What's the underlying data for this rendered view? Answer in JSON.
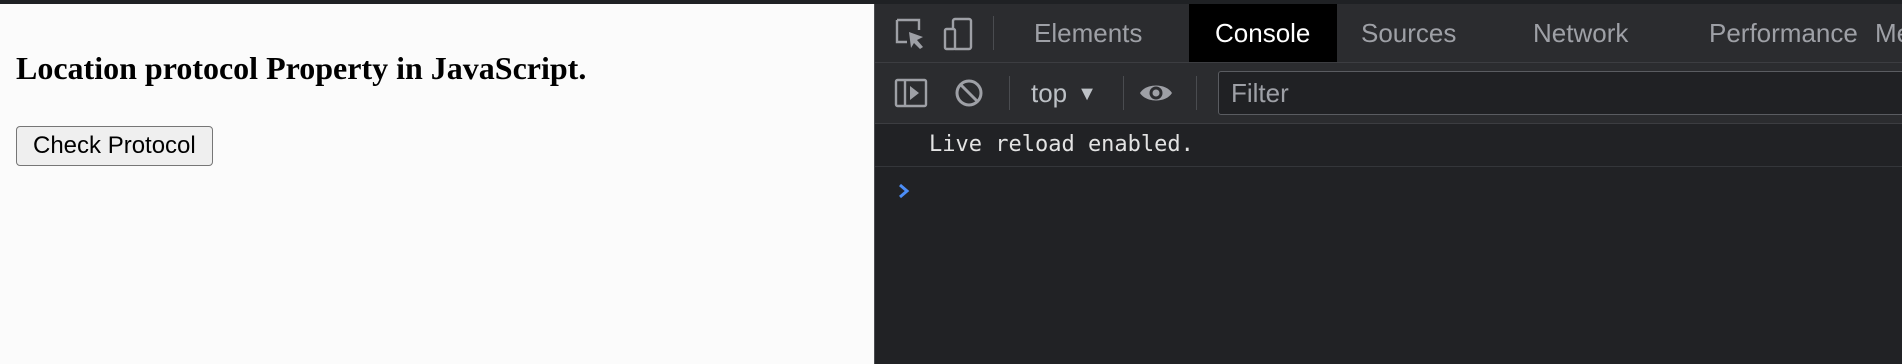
{
  "page": {
    "heading": "Location protocol Property in JavaScript.",
    "button_label": "Check Protocol"
  },
  "devtools": {
    "toolbar_icons": [
      "inspect-element-icon",
      "device-toolbar-icon"
    ],
    "tabs": [
      {
        "label": "Elements",
        "active": false
      },
      {
        "label": "Console",
        "active": true
      },
      {
        "label": "Sources",
        "active": false
      },
      {
        "label": "Network",
        "active": false
      },
      {
        "label": "Performance",
        "active": false
      },
      {
        "label": "Me",
        "active": false
      }
    ],
    "console_toolbar": {
      "icons": [
        "sidebar-toggle-icon",
        "clear-console-icon",
        "eye-icon"
      ],
      "context": "top",
      "filter_placeholder": "Filter"
    },
    "console_messages": [
      "Live reload enabled."
    ],
    "prompt_icon": "chevron-right-icon",
    "colors": {
      "panel_bg": "#212225",
      "toolbar_bg": "#2b2c2f",
      "active_tab_bg": "#000000",
      "prompt_accent": "#4c8df6"
    }
  }
}
